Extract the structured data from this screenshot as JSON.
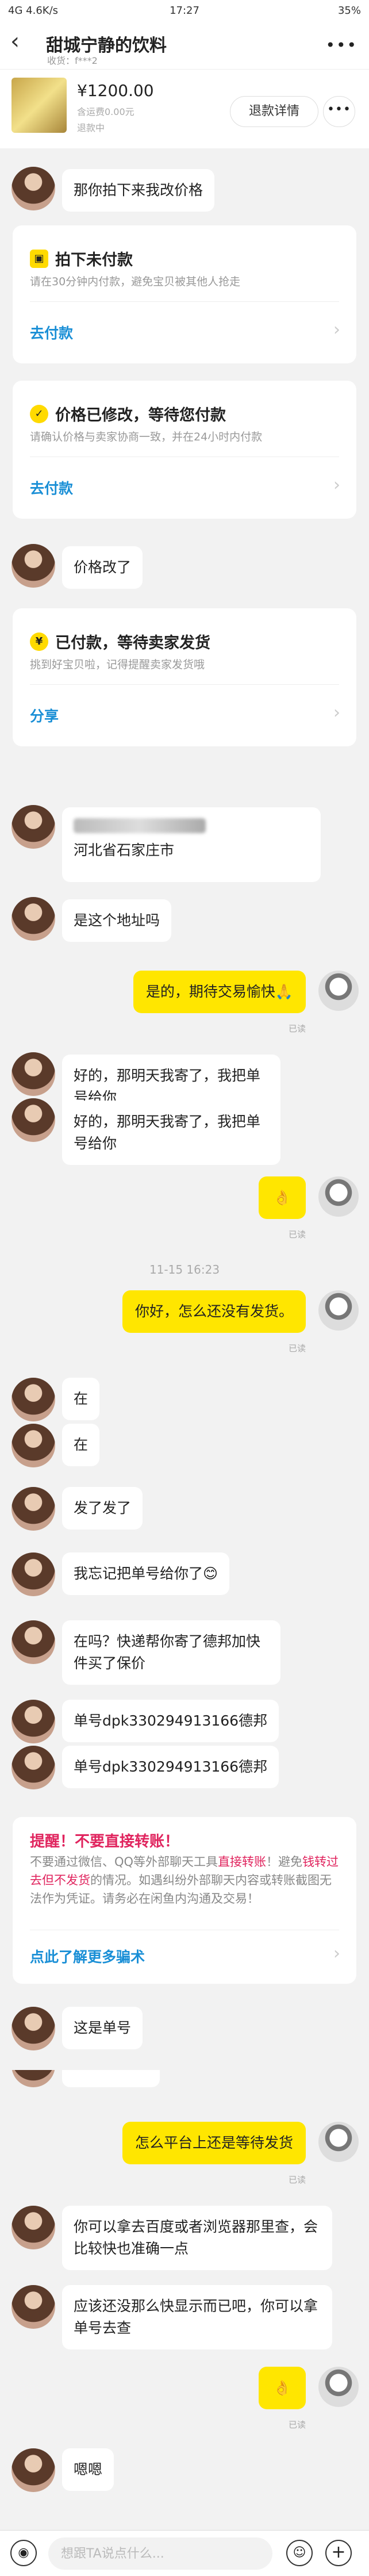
{
  "status_bar": {
    "network": "4G",
    "speed": "4.6K/s",
    "time": "17:27",
    "battery": "35%"
  },
  "header": {
    "back_glyph": "‹",
    "title": "甜城宁静的饮料",
    "subtitle": "收货：f***2",
    "more_glyph": "•••"
  },
  "product": {
    "price": "¥1200.00",
    "shipping": "含运费0.00元",
    "refund_status": "退款中",
    "refund_button": "退款详情",
    "more_button": "•••"
  },
  "messages": {
    "m1": "那你拍下来我改价格",
    "m2": "价格改了",
    "m3": "河北省石家庄市",
    "m4": "是这个地址吗",
    "m5": "是的，期待交易愉快🙏",
    "m5_read": "已读",
    "m6": "好的，那明天我寄了，我把单号给你",
    "m7": "好的，那明天我寄了，我把单号给你",
    "m8": "👌",
    "m8_read": "已读",
    "time_divider": "11-15 16:23",
    "m9": "你好，怎么还没有发货。",
    "m9_read": "已读",
    "m10": "在",
    "m11": "在",
    "m12": "发了发了",
    "m13": "我忘记把单号给你了😊",
    "m14": "在吗？快递帮你寄了德邦加快件买了保价",
    "m15": "单号dpk330294913166德邦",
    "m16": "单号dpk330294913166德邦",
    "m17": "这是单号",
    "m18": "怎么平台上还是等待发货",
    "m18_read": "已读",
    "m19": "你可以拿去百度或者浏览器那里查，会比较快也准确一点",
    "m20": "应该还没那么快显示而已吧，你可以拿单号去查",
    "m21": "👌",
    "m21_read": "已读",
    "m22": "嗯嗯"
  },
  "cards": {
    "unpaid": {
      "icon": "▣",
      "title": "拍下未付款",
      "desc": "请在30分钟内付款，避免宝贝被其他人抢走",
      "link": "去付款"
    },
    "price_changed": {
      "icon": "✓",
      "title": "价格已修改，等待您付款",
      "desc": "请确认价格与卖家协商一致，并在24小时内付款",
      "link": "去付款"
    },
    "paid": {
      "icon": "¥",
      "title": "已付款，等待卖家发货",
      "desc": "挑到好宝贝啦，记得提醒卖家发货哦",
      "link": "分享"
    },
    "warning": {
      "title": "提醒！不要直接转账！",
      "body_1": "不要通过微信、QQ等外部聊天工具",
      "body_red_1": "直接转账",
      "body_2": "！避免",
      "body_red_2": "钱转过去但不发货",
      "body_3": "的情况。如遇纠纷外部聊天内容或转账截图无法作为凭证。请务必在闲鱼内沟通及交易！",
      "link": "点此了解更多骗术"
    }
  },
  "chevron": "›",
  "bottom_bar": {
    "voice_glyph": "◉",
    "placeholder": "想跟TA说点什么...",
    "emoji_glyph": "☺",
    "plus_glyph": "+"
  }
}
